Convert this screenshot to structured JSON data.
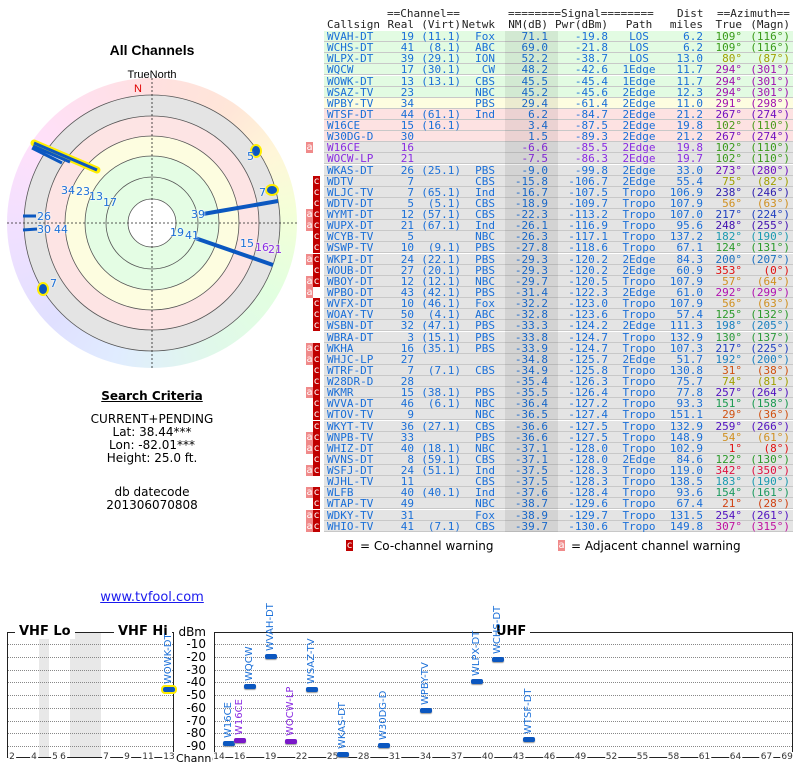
{
  "polar": {
    "title": "All Channels",
    "north_label": "TrueNorth",
    "north_marker": "N",
    "labels": [
      "5",
      "7",
      "34",
      "23",
      "13",
      "17",
      "26",
      "30",
      "44",
      "39",
      "19",
      "41",
      "15",
      "16",
      "21",
      "7"
    ],
    "label_colors": {
      "normal": "#1a6fd8",
      "adjacent": "#8a2be2",
      "north": "#e00000"
    }
  },
  "search": {
    "title": "Search Criteria",
    "mode": "CURRENT+PENDING",
    "lat": "Lat: 38.44***",
    "lon": "Lon: -82.01***",
    "height": "Height: 25.0 ft.",
    "datecode_label": "db datecode",
    "datecode": "201306070808",
    "link": "www.tvfool.com"
  },
  "table": {
    "group_headers": {
      "channel": "==Channel==",
      "signal": "========Signal========",
      "dist": "Dist",
      "azimuth": "==Azimuth=="
    },
    "columns": [
      "Callsign",
      "Real",
      "(Virt)",
      "Netwk",
      "NM(dB)",
      "Pwr(dBm)",
      "Path",
      "miles",
      "True",
      "(Magn)"
    ],
    "zone_colors": {
      "green": "#e2fbe2",
      "yellow": "#fdfde0",
      "pink": "#fde2e2",
      "gray": "#e4e4e4"
    },
    "rows": [
      {
        "w": "",
        "z": "green",
        "tc": "#1a6fd8",
        "ac": "#3a9a1a",
        "c": [
          "WVAH-DT",
          "19",
          "(11.1)",
          "Fox",
          "71.1",
          "-19.8",
          "LOS",
          "6.2",
          "109°",
          "(116°)"
        ]
      },
      {
        "w": "",
        "z": "green",
        "tc": "#1a6fd8",
        "ac": "#3a9a1a",
        "c": [
          "WCHS-DT",
          "41",
          "(8.1)",
          "ABC",
          "69.0",
          "-21.8",
          "LOS",
          "6.2",
          "109°",
          "(116°)"
        ]
      },
      {
        "w": "",
        "z": "green",
        "tc": "#1a6fd8",
        "ac": "#a0a000",
        "c": [
          "WLPX-DT",
          "39",
          "(29.1)",
          "ION",
          "52.2",
          "-38.7",
          "LOS",
          "13.0",
          "80°",
          "(87°)"
        ]
      },
      {
        "w": "",
        "z": "green",
        "tc": "#1a6fd8",
        "ac": "#a010b0",
        "c": [
          "WQCW",
          "17",
          "(30.1)",
          "CW",
          "48.2",
          "-42.6",
          "1Edge",
          "11.7",
          "294°",
          "(301°)"
        ]
      },
      {
        "w": "",
        "z": "green",
        "tc": "#1a6fd8",
        "ac": "#a010b0",
        "c": [
          "WOWK-DT",
          "13",
          "(13.1)",
          "CBS",
          "45.5",
          "-45.4",
          "1Edge",
          "11.7",
          "294°",
          "(301°)"
        ]
      },
      {
        "w": "",
        "z": "green",
        "tc": "#1a6fd8",
        "ac": "#a010b0",
        "c": [
          "WSAZ-TV",
          "23",
          "",
          "NBC",
          "45.2",
          "-45.6",
          "2Edge",
          "12.3",
          "294°",
          "(301°)"
        ]
      },
      {
        "w": "",
        "z": "yellow",
        "tc": "#1a6fd8",
        "ac": "#a010b0",
        "c": [
          "WPBY-TV",
          "34",
          "",
          "PBS",
          "29.4",
          "-61.4",
          "2Edge",
          "11.0",
          "291°",
          "(298°)"
        ]
      },
      {
        "w": "",
        "z": "pink",
        "tc": "#1a6fd8",
        "ac": "#7010c0",
        "c": [
          "WTSF-DT",
          "44",
          "(61.1)",
          "Ind",
          "6.2",
          "-84.7",
          "2Edge",
          "21.2",
          "267°",
          "(274°)"
        ]
      },
      {
        "w": "",
        "z": "pink",
        "tc": "#1a6fd8",
        "ac": "#4a9a1a",
        "c": [
          "W16CE",
          "15",
          "(16.1)",
          "",
          "3.4",
          "-87.5",
          "2Edge",
          "19.8",
          "102°",
          "(110°)"
        ]
      },
      {
        "w": "",
        "z": "pink",
        "tc": "#1a6fd8",
        "ac": "#7010c0",
        "c": [
          "W30DG-D",
          "30",
          "",
          "",
          "1.5",
          "-89.3",
          "2Edge",
          "21.2",
          "267°",
          "(274°)"
        ]
      },
      {
        "w": "a",
        "z": "gray",
        "tc": "#8a2be2",
        "ac": "#3a9a1a",
        "c": [
          "W16CE",
          "16",
          "",
          "",
          "-6.6",
          "-85.5",
          "2Edge",
          "19.8",
          "102°",
          "(110°)"
        ]
      },
      {
        "w": "",
        "z": "gray",
        "tc": "#8a2be2",
        "ac": "#3a9a1a",
        "c": [
          "WOCW-LP",
          "21",
          "",
          "",
          "-7.5",
          "-86.3",
          "2Edge",
          "19.7",
          "102°",
          "(110°)"
        ]
      },
      {
        "w": "",
        "z": "gray",
        "tc": "#1a6fd8",
        "ac": "#7010c0",
        "c": [
          "WKAS-DT",
          "26",
          "(25.1)",
          "PBS",
          "-9.0",
          "-99.8",
          "2Edge",
          "33.0",
          "273°",
          "(280°)"
        ]
      },
      {
        "w": "c",
        "z": "gray",
        "tc": "#1a6fd8",
        "ac": "#a0a000",
        "c": [
          "WDTV",
          "7",
          "",
          "CBS",
          "-15.8",
          "-106.7",
          "2Edge",
          "55.4",
          "75°",
          "(82°)"
        ]
      },
      {
        "w": "c",
        "z": "gray",
        "tc": "#1a6fd8",
        "ac": "#3020b0",
        "c": [
          "WLJC-TV",
          "7",
          "(65.1)",
          "Ind",
          "-16.7",
          "-107.5",
          "Tropo",
          "106.9",
          "238°",
          "(246°)"
        ]
      },
      {
        "w": "c",
        "z": "gray",
        "tc": "#1a6fd8",
        "ac": "#d09020",
        "c": [
          "WDTV-DT",
          "5",
          "(5.1)",
          "CBS",
          "-18.9",
          "-109.7",
          "Tropo",
          "107.9",
          "56°",
          "(63°)"
        ]
      },
      {
        "w": "ac",
        "z": "gray",
        "tc": "#1a6fd8",
        "ac": "#2040c0",
        "c": [
          "WYMT-DT",
          "12",
          "(57.1)",
          "CBS",
          "-22.3",
          "-113.2",
          "Tropo",
          "107.0",
          "217°",
          "(224°)"
        ]
      },
      {
        "w": "ac",
        "z": "gray",
        "tc": "#1a6fd8",
        "ac": "#4010b0",
        "c": [
          "WUPX-DT",
          "21",
          "(67.1)",
          "Ind",
          "-26.1",
          "-116.9",
          "Tropo",
          "95.6",
          "248°",
          "(255°)"
        ]
      },
      {
        "w": "c",
        "z": "gray",
        "tc": "#1a6fd8",
        "ac": "#1a9ab0",
        "c": [
          "WCYB-TV",
          "5",
          "",
          "NBC",
          "-26.3",
          "-117.1",
          "Tropo",
          "137.2",
          "182°",
          "(190°)"
        ]
      },
      {
        "w": "c",
        "z": "gray",
        "tc": "#1a6fd8",
        "ac": "#2a9a2a",
        "c": [
          "WSWP-TV",
          "10",
          "(9.1)",
          "PBS",
          "-27.8",
          "-118.6",
          "Tropo",
          "67.1",
          "124°",
          "(131°)"
        ]
      },
      {
        "w": "ac",
        "z": "gray",
        "tc": "#1a6fd8",
        "ac": "#1a70c0",
        "c": [
          "WKPI-DT",
          "24",
          "(22.1)",
          "PBS",
          "-29.3",
          "-120.2",
          "2Edge",
          "84.3",
          "200°",
          "(207°)"
        ]
      },
      {
        "w": "c",
        "z": "gray",
        "tc": "#1a6fd8",
        "ac": "#e01010",
        "c": [
          "WOUB-DT",
          "27",
          "(20.1)",
          "PBS",
          "-29.3",
          "-120.2",
          "2Edge",
          "60.9",
          "353°",
          "(0°)"
        ]
      },
      {
        "w": "ac",
        "z": "gray",
        "tc": "#1a6fd8",
        "ac": "#d09020",
        "c": [
          "WBOY-DT",
          "12",
          "(12.1)",
          "NBC",
          "-29.7",
          "-120.5",
          "Tropo",
          "107.9",
          "57°",
          "(64°)"
        ]
      },
      {
        "w": "a",
        "z": "gray",
        "tc": "#1a6fd8",
        "ac": "#b010b0",
        "c": [
          "WPBO-DT",
          "43",
          "(42.1)",
          "PBS",
          "-31.4",
          "-122.3",
          "2Edge",
          "61.0",
          "292°",
          "(299°)"
        ]
      },
      {
        "w": "c",
        "z": "gray",
        "tc": "#1a6fd8",
        "ac": "#d09020",
        "c": [
          "WVFX-DT",
          "10",
          "(46.1)",
          "Fox",
          "-32.2",
          "-123.0",
          "Tropo",
          "107.9",
          "56°",
          "(63°)"
        ]
      },
      {
        "w": "c",
        "z": "gray",
        "tc": "#1a6fd8",
        "ac": "#2a9a2a",
        "c": [
          "WOAY-TV",
          "50",
          "(4.1)",
          "ABC",
          "-32.8",
          "-123.6",
          "Tropo",
          "57.4",
          "125°",
          "(132°)"
        ]
      },
      {
        "w": "c",
        "z": "gray",
        "tc": "#1a6fd8",
        "ac": "#1a80c0",
        "c": [
          "WSBN-DT",
          "32",
          "(47.1)",
          "PBS",
          "-33.3",
          "-124.2",
          "2Edge",
          "111.3",
          "198°",
          "(205°)"
        ]
      },
      {
        "w": "",
        "z": "gray",
        "tc": "#1a6fd8",
        "ac": "#2a9a3a",
        "c": [
          "WBRA-DT",
          "3",
          "(15.1)",
          "PBS",
          "-33.8",
          "-124.7",
          "Tropo",
          "132.9",
          "130°",
          "(137°)"
        ]
      },
      {
        "w": "ac",
        "z": "gray",
        "tc": "#1a6fd8",
        "ac": "#2040c0",
        "c": [
          "WKHA",
          "16",
          "(35.1)",
          "PBS",
          "-33.9",
          "-124.7",
          "Tropo",
          "107.3",
          "217°",
          "(225°)"
        ]
      },
      {
        "w": "ac",
        "z": "gray",
        "tc": "#1a6fd8",
        "ac": "#1a80c0",
        "c": [
          "WHJC-LP",
          "27",
          "",
          "",
          "-34.8",
          "-125.7",
          "2Edge",
          "51.7",
          "192°",
          "(200°)"
        ]
      },
      {
        "w": "c",
        "z": "gray",
        "tc": "#1a6fd8",
        "ac": "#d05010",
        "c": [
          "WTRF-DT",
          "7",
          "(7.1)",
          "CBS",
          "-34.9",
          "-125.8",
          "Tropo",
          "130.8",
          "31°",
          "(38°)"
        ]
      },
      {
        "w": "c",
        "z": "gray",
        "tc": "#1a6fd8",
        "ac": "#a0a000",
        "c": [
          "W28DR-D",
          "28",
          "",
          "",
          "-35.4",
          "-126.3",
          "Tropo",
          "75.7",
          "74°",
          "(81°)"
        ]
      },
      {
        "w": "ac",
        "z": "gray",
        "tc": "#1a6fd8",
        "ac": "#5010c0",
        "c": [
          "WKMR",
          "15",
          "(38.1)",
          "PBS",
          "-35.5",
          "-126.4",
          "Tropo",
          "77.8",
          "257°",
          "(264°)"
        ]
      },
      {
        "w": "c",
        "z": "gray",
        "tc": "#1a6fd8",
        "ac": "#1a9a50",
        "c": [
          "WVVA-DT",
          "46",
          "(6.1)",
          "NBC",
          "-36.4",
          "-127.2",
          "Tropo",
          "93.3",
          "151°",
          "(158°)"
        ]
      },
      {
        "w": "c",
        "z": "gray",
        "tc": "#1a6fd8",
        "ac": "#d05010",
        "c": [
          "WTOV-TV",
          "9",
          "",
          "NBC",
          "-36.5",
          "-127.4",
          "Tropo",
          "151.1",
          "29°",
          "(36°)"
        ]
      },
      {
        "w": "c",
        "z": "gray",
        "tc": "#1a6fd8",
        "ac": "#5010c0",
        "c": [
          "WKYT-TV",
          "36",
          "(27.1)",
          "CBS",
          "-36.6",
          "-127.5",
          "Tropo",
          "132.9",
          "259°",
          "(266°)"
        ]
      },
      {
        "w": "ac",
        "z": "gray",
        "tc": "#1a6fd8",
        "ac": "#d09020",
        "c": [
          "WNPB-TV",
          "33",
          "",
          "PBS",
          "-36.6",
          "-127.5",
          "Tropo",
          "148.9",
          "54°",
          "(61°)"
        ]
      },
      {
        "w": "ac",
        "z": "gray",
        "tc": "#1a6fd8",
        "ac": "#e01010",
        "c": [
          "WHIZ-DT",
          "40",
          "(18.1)",
          "NBC",
          "-37.1",
          "-128.0",
          "Tropo",
          "102.9",
          "1°",
          "(8°)"
        ]
      },
      {
        "w": "c",
        "z": "gray",
        "tc": "#1a6fd8",
        "ac": "#2a9a2a",
        "c": [
          "WVNS-DT",
          "8",
          "(59.1)",
          "CBS",
          "-37.1",
          "-128.0",
          "2Edge",
          "84.6",
          "122°",
          "(130°)"
        ]
      },
      {
        "w": "ac",
        "z": "gray",
        "tc": "#1a6fd8",
        "ac": "#e01040",
        "c": [
          "WSFJ-DT",
          "24",
          "(51.1)",
          "Ind",
          "-37.5",
          "-128.3",
          "Tropo",
          "119.0",
          "342°",
          "(350°)"
        ]
      },
      {
        "w": "",
        "z": "gray",
        "tc": "#1a6fd8",
        "ac": "#1a9ab0",
        "c": [
          "WJHL-TV",
          "11",
          "",
          "CBS",
          "-37.5",
          "-128.3",
          "Tropo",
          "138.5",
          "183°",
          "(190°)"
        ]
      },
      {
        "w": "ac",
        "z": "gray",
        "tc": "#1a6fd8",
        "ac": "#1a9a60",
        "c": [
          "WLFB",
          "40",
          "(40.1)",
          "Ind",
          "-37.6",
          "-128.4",
          "Tropo",
          "93.6",
          "154°",
          "(161°)"
        ]
      },
      {
        "w": "c",
        "z": "gray",
        "tc": "#1a6fd8",
        "ac": "#d04010",
        "c": [
          "WTAP-TV",
          "49",
          "",
          "NBC",
          "-38.7",
          "-129.6",
          "Tropo",
          "67.4",
          "21°",
          "(28°)"
        ]
      },
      {
        "w": "ac",
        "z": "gray",
        "tc": "#1a6fd8",
        "ac": "#5010c0",
        "c": [
          "WDKY-TV",
          "31",
          "",
          "Fox",
          "-38.9",
          "-129.7",
          "Tropo",
          "131.5",
          "254°",
          "(261°)"
        ]
      },
      {
        "w": "ac",
        "z": "gray",
        "tc": "#1a6fd8",
        "ac": "#c010a0",
        "c": [
          "WHIO-TV",
          "41",
          "(7.1)",
          "CBS",
          "-39.7",
          "-130.6",
          "Tropo",
          "149.8",
          "307°",
          "(315°)"
        ]
      }
    ],
    "legend": {
      "co_symbol": "c",
      "co_text": "= Co-channel warning",
      "adj_symbol": "a",
      "adj_text": "= Adjacent channel warning",
      "co_color": "#c00000",
      "adj_color": "#f08a8a"
    }
  },
  "chart_data": {
    "type": "scatter",
    "ylabel": "dBm",
    "xlabel": "Channel",
    "ylim": [
      -90,
      -10
    ],
    "yticks": [
      "-10",
      "-20",
      "-30",
      "-40",
      "-50",
      "-60",
      "-70",
      "-80",
      "-90"
    ],
    "panels": [
      "VHF Lo",
      "VHF Hi",
      "UHF"
    ],
    "vhf_ticks": [
      "2",
      "4",
      "5",
      "6",
      "7",
      "9",
      "11",
      "13"
    ],
    "uhf_ticks": [
      "14",
      "16",
      "19",
      "22",
      "25",
      "28",
      "31",
      "34",
      "37",
      "40",
      "43",
      "46",
      "49",
      "52",
      "55",
      "58",
      "61",
      "64",
      "67",
      "69"
    ],
    "grid": true,
    "points": [
      {
        "name": "WOWK-DT",
        "ch": 13,
        "dbm": -45.4,
        "color": "#1a6fd8",
        "highlight": true
      },
      {
        "name": "W16CE",
        "ch": 15,
        "dbm": -87.5,
        "color": "#1a6fd8"
      },
      {
        "name": "W16CE",
        "ch": 16,
        "dbm": -85.5,
        "color": "#8a2be2"
      },
      {
        "name": "WQCW",
        "ch": 17,
        "dbm": -42.6,
        "color": "#1a6fd8"
      },
      {
        "name": "WVAH-DT",
        "ch": 19,
        "dbm": -19.8,
        "color": "#1a6fd8"
      },
      {
        "name": "WOCW-LP",
        "ch": 21,
        "dbm": -86.3,
        "color": "#8a2be2"
      },
      {
        "name": "WSAZ-TV",
        "ch": 23,
        "dbm": -45.6,
        "color": "#1a6fd8"
      },
      {
        "name": "WKAS-DT",
        "ch": 26,
        "dbm": -99.8,
        "color": "#1a6fd8"
      },
      {
        "name": "W30DG-D",
        "ch": 30,
        "dbm": -89.3,
        "color": "#1a6fd8"
      },
      {
        "name": "WPBY-TV",
        "ch": 34,
        "dbm": -61.4,
        "color": "#1a6fd8"
      },
      {
        "name": "WLPX-DT",
        "ch": 39,
        "dbm": -38.7,
        "color": "#1a6fd8"
      },
      {
        "name": "WCHS-DT",
        "ch": 41,
        "dbm": -21.8,
        "color": "#1a6fd8"
      },
      {
        "name": "WTSF-DT",
        "ch": 44,
        "dbm": -84.7,
        "color": "#1a6fd8"
      }
    ]
  }
}
